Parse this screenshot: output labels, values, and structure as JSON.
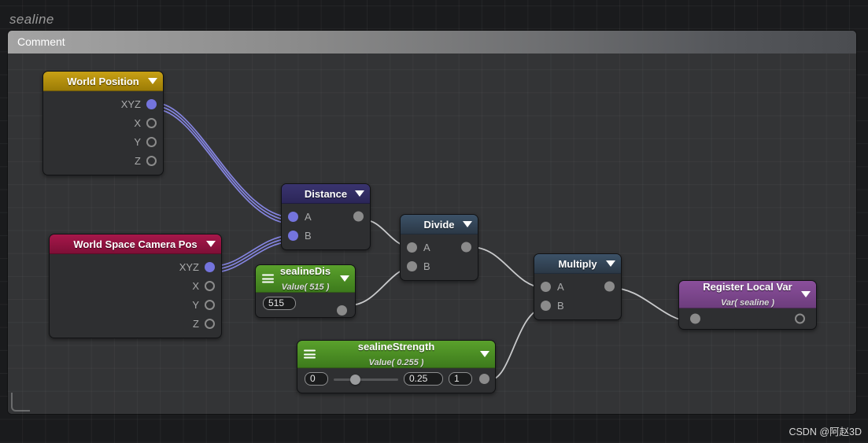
{
  "app": {
    "graph_title": "sealine",
    "watermark": "CSDN @阿赵3D",
    "canvas_bg": "#1a1b1d",
    "comment_bg": "#333436"
  },
  "comment_group": {
    "label": "Comment",
    "header_color": "#8a8a8a"
  },
  "nodes": {
    "world_position": {
      "title": "World Position",
      "header_color": "#b8951a",
      "ports": [
        {
          "label": "XYZ",
          "style": "filled-vector",
          "color": "#7474dd"
        },
        {
          "label": "X",
          "style": "hollow",
          "color": "#8b8b8b"
        },
        {
          "label": "Y",
          "style": "hollow",
          "color": "#8b8b8b"
        },
        {
          "label": "Z",
          "style": "hollow",
          "color": "#8b8b8b"
        }
      ]
    },
    "world_space_camera_pos": {
      "title": "World Space Camera Pos",
      "header_color": "#a7174a",
      "ports": [
        {
          "label": "XYZ",
          "style": "filled-vector",
          "color": "#7474dd"
        },
        {
          "label": "X",
          "style": "hollow",
          "color": "#8b8b8b"
        },
        {
          "label": "Y",
          "style": "hollow",
          "color": "#8b8b8b"
        },
        {
          "label": "Z",
          "style": "hollow",
          "color": "#8b8b8b"
        }
      ]
    },
    "distance": {
      "title": "Distance",
      "header_color": "#3a3470",
      "inputs": [
        {
          "label": "A",
          "color": "#7474dd"
        },
        {
          "label": "B",
          "color": "#7474dd"
        }
      ],
      "output": {
        "label": "",
        "color": "#8b8b8b"
      }
    },
    "divide": {
      "title": "Divide",
      "header_color": "#3c5268",
      "inputs": [
        {
          "label": "A",
          "color": "#8b8b8b"
        },
        {
          "label": "B",
          "color": "#8b8b8b"
        }
      ],
      "output": {
        "label": "",
        "color": "#8b8b8b"
      }
    },
    "multiply": {
      "title": "Multiply",
      "header_color": "#3c5268",
      "inputs": [
        {
          "label": "A",
          "color": "#8b8b8b"
        },
        {
          "label": "B",
          "color": "#8b8b8b"
        }
      ],
      "output": {
        "label": "",
        "color": "#8b8b8b"
      }
    },
    "sealine_dis": {
      "title": "sealineDis",
      "subtitle": "Value( 515 )",
      "header_color": "#4d8f22",
      "value": "515",
      "output": {
        "color": "#8b8b8b"
      }
    },
    "sealine_strength": {
      "title": "sealineStrength",
      "subtitle": "Value( 0.255 )",
      "header_color": "#4d8f22",
      "min": "0",
      "value": "0.25",
      "max": "1",
      "slider_percent": 25,
      "output": {
        "color": "#8b8b8b"
      }
    },
    "register_local_var": {
      "title": "Register Local Var",
      "subtitle": "Var( sealine )",
      "header_color": "#8a4f9b",
      "input": {
        "color": "#8b8b8b"
      },
      "output": {
        "color": "#8b8b8b",
        "style": "hollow"
      }
    }
  },
  "wires": {
    "vector_color": "#8484e0",
    "scalar_color": "#c9cacc",
    "connections": [
      {
        "from": "world_position.XYZ",
        "to": "distance.A",
        "type": "vector"
      },
      {
        "from": "world_space_camera_pos.XYZ",
        "to": "distance.B",
        "type": "vector"
      },
      {
        "from": "distance.out",
        "to": "divide.A",
        "type": "scalar"
      },
      {
        "from": "sealine_dis.out",
        "to": "divide.B",
        "type": "scalar"
      },
      {
        "from": "divide.out",
        "to": "multiply.A",
        "type": "scalar"
      },
      {
        "from": "sealine_strength.out",
        "to": "multiply.B",
        "type": "scalar"
      },
      {
        "from": "multiply.out",
        "to": "register_local_var.in",
        "type": "scalar"
      }
    ]
  }
}
